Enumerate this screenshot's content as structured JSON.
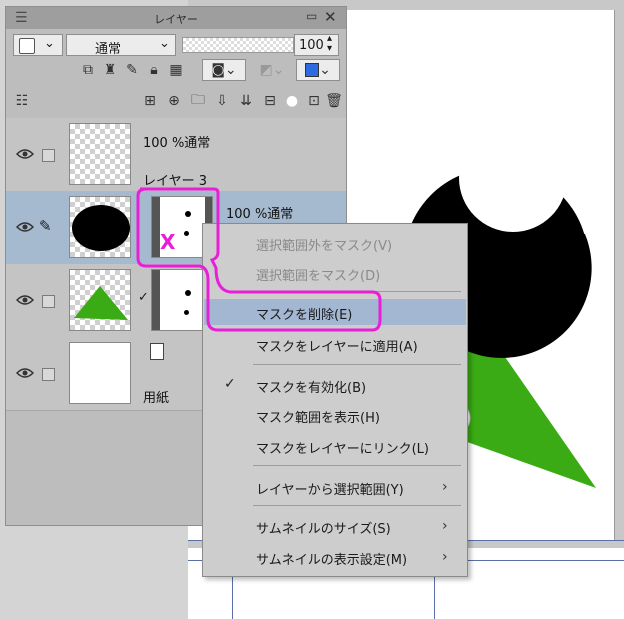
{
  "panel": {
    "title": "レイヤー",
    "blend_mode": "通常",
    "opacity": "100"
  },
  "layers": [
    {
      "opacity_mode": "100 %通常",
      "name": "レイヤー 3"
    },
    {
      "opacity_mode": "100 %通常",
      "name": ""
    },
    {
      "opacity_mode": "",
      "name": ""
    },
    {
      "opacity_mode": "",
      "name": "用紙"
    }
  ],
  "menu": {
    "items": [
      {
        "label": "選択範囲外をマスク(V)",
        "disabled": true
      },
      {
        "label": "選択範囲をマスク(D)",
        "disabled": true
      },
      {
        "label": "マスクを削除(E)",
        "highlighted": true
      },
      {
        "label": "マスクをレイヤーに適用(A)"
      },
      {
        "label": "マスクを有効化(B)",
        "checked": true
      },
      {
        "label": "マスク範囲を表示(H)"
      },
      {
        "label": "マスクをレイヤーにリンク(L)"
      },
      {
        "label": "レイヤーから選択範囲(Y)",
        "submenu": true
      },
      {
        "label": "サムネイルのサイズ(S)",
        "submenu": true
      },
      {
        "label": "サムネイルの表示設定(M)",
        "submenu": true
      }
    ]
  },
  "annotation": {
    "color": "#e81fd6",
    "mark": "X"
  },
  "colors": {
    "shape_black": "#000000",
    "shape_green": "#3aab14",
    "selection": "#a5b9cf"
  }
}
